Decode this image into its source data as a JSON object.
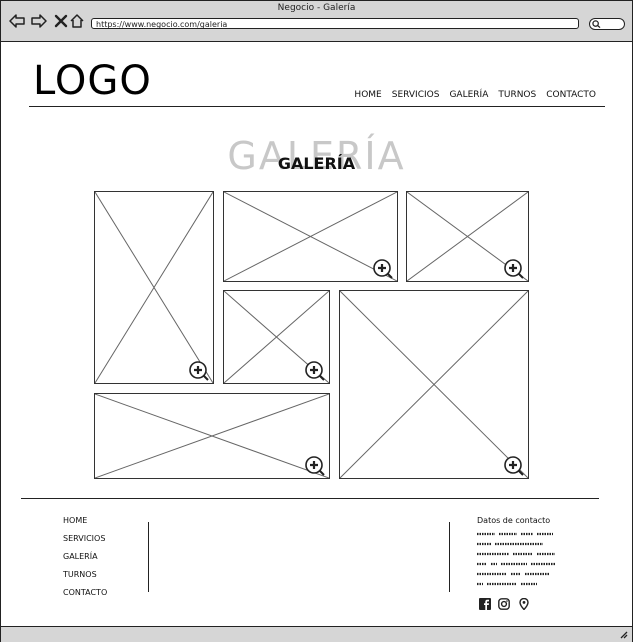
{
  "window": {
    "title": "Negocio - Galería",
    "url": "https://www.negocio.com/galeria"
  },
  "icons": {
    "back": "arrow-left-icon",
    "forward": "arrow-right-icon",
    "close": "close-icon",
    "home": "home-icon",
    "search": "search-icon"
  },
  "header": {
    "logo": "LOGO",
    "nav": [
      "HOME",
      "SERVICIOS",
      "GALERÍA",
      "TURNOS",
      "CONTACTO"
    ]
  },
  "gallery": {
    "title_big": "GALERÍA",
    "title_small": "GALERÍA",
    "tiles": 6
  },
  "footer": {
    "nav": [
      "HOME",
      "SERVICIOS",
      "GALERÍA",
      "TURNOS",
      "CONTACTO"
    ],
    "contact_title": "Datos de contacto"
  }
}
